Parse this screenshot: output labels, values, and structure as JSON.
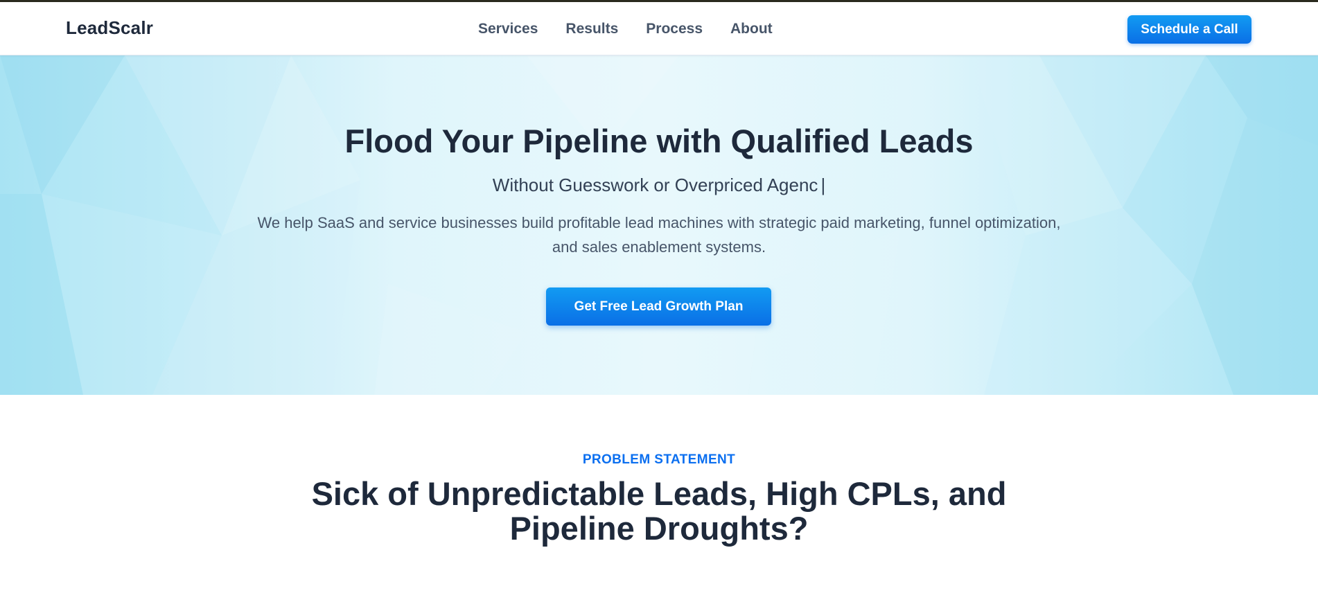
{
  "brand": {
    "logo": "LeadScalr",
    "accent_color": "#0a6fe6",
    "hero_bg_color": "#dff5fb"
  },
  "nav": {
    "items": [
      {
        "label": "Services"
      },
      {
        "label": "Results"
      },
      {
        "label": "Process"
      },
      {
        "label": "About"
      }
    ],
    "cta_label": "Schedule a Call"
  },
  "hero": {
    "title": "Flood Your Pipeline with Qualified Leads",
    "subtitle": "Without Guesswork or Overpriced Agenc",
    "caret": "|",
    "description": "We help SaaS and service businesses build profitable lead machines with strategic paid marketing, funnel optimization, and sales enablement systems.",
    "cta_label": "Get Free Lead Growth Plan"
  },
  "problem": {
    "eyebrow": "PROBLEM STATEMENT",
    "title": "Sick of Unpredictable Leads, High CPLs, and Pipeline Droughts?"
  }
}
